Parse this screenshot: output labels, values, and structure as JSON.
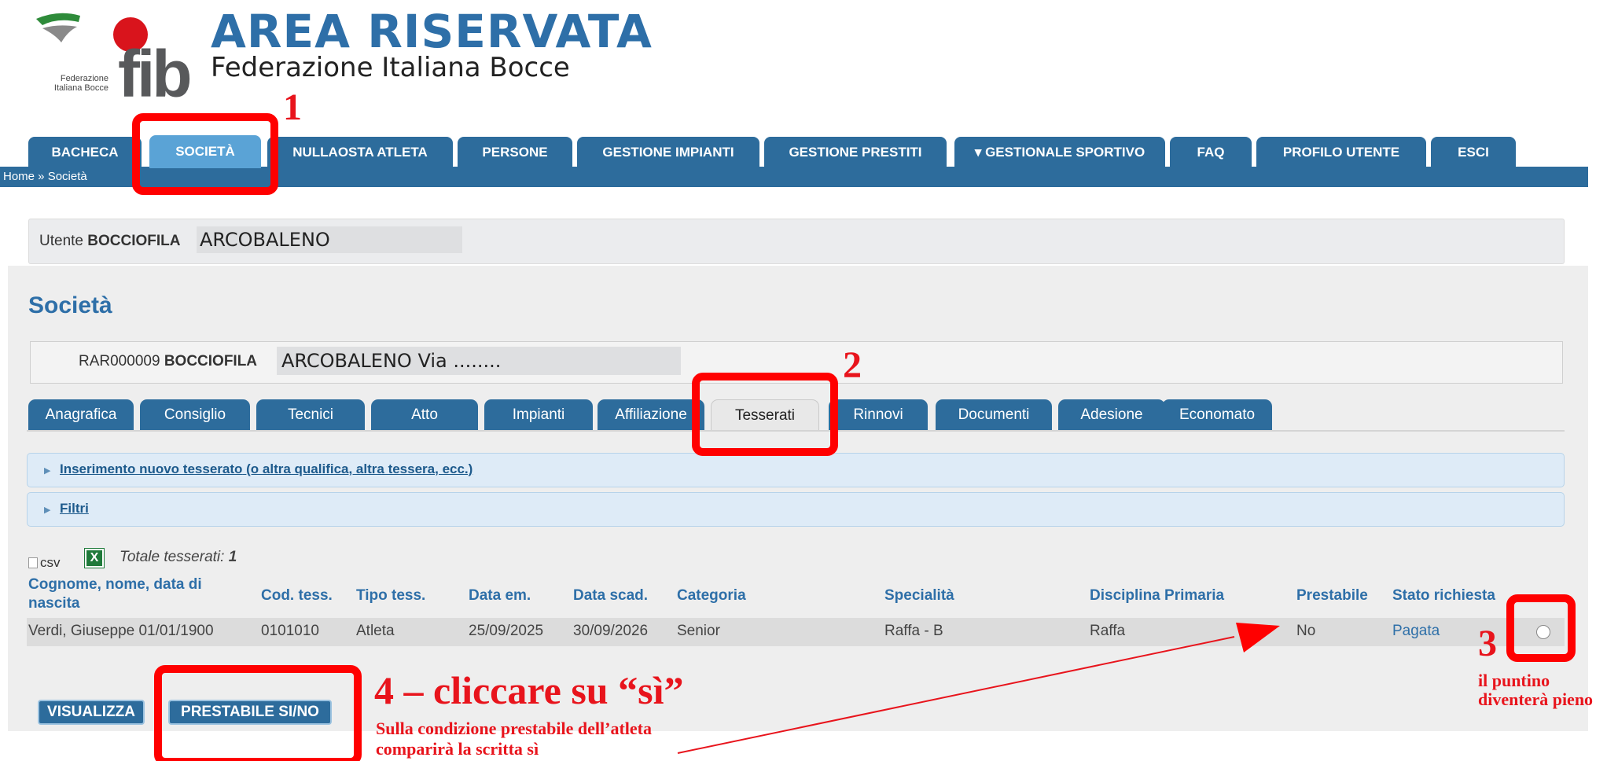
{
  "header": {
    "logo_word": "fib",
    "logo_sub_line1": "Federazione",
    "logo_sub_line2": "Italiana Bocce",
    "title": "AREA RISERVATA",
    "subtitle": "Federazione Italiana Bocce"
  },
  "nav": {
    "tabs": [
      {
        "label": "BACHECA"
      },
      {
        "label": "SOCIETÀ"
      },
      {
        "label": "NULLAOSTA ATLETA"
      },
      {
        "label": "PERSONE"
      },
      {
        "label": "GESTIONE IMPIANTI"
      },
      {
        "label": "GESTIONE PRESTITI"
      },
      {
        "label": "▾ GESTIONALE SPORTIVO"
      },
      {
        "label": "FAQ"
      },
      {
        "label": "PROFILO UTENTE"
      },
      {
        "label": "ESCI"
      }
    ],
    "active": "SOCIETÀ",
    "breadcrumb": "Home » Società"
  },
  "user": {
    "prefix": "Utente",
    "role": "BOCCIOFILA",
    "name": "ARCOBALENO"
  },
  "page": {
    "title": "Società",
    "society_code": "RAR000009",
    "society_type": "BOCCIOFILA",
    "society_name": "ARCOBALENO Via ........"
  },
  "sub_tabs": {
    "items": [
      {
        "label": "Anagrafica"
      },
      {
        "label": "Consiglio"
      },
      {
        "label": "Tecnici"
      },
      {
        "label": "Atto"
      },
      {
        "label": "Impianti"
      },
      {
        "label": "Affiliazione"
      },
      {
        "label": "Tesserati"
      },
      {
        "label": "Rinnovi"
      },
      {
        "label": "Documenti"
      },
      {
        "label": "Adesione"
      },
      {
        "label": "Economato"
      }
    ],
    "active": "Tesserati"
  },
  "accordions": {
    "new_member_link": "Inserimento nuovo tesserato",
    "new_member_note": "(o altra qualifica, altra tessera, ecc.)",
    "filters_link": "Filtri"
  },
  "table": {
    "csv_alt": "csv",
    "xls_icon_letter": "X",
    "total_label": "Totale tesserati:",
    "total_value": "1",
    "columns": {
      "name": "Cognome, nome, data di nascita",
      "code": "Cod. tess.",
      "type": "Tipo tess.",
      "issued": "Data em.",
      "expiry": "Data scad.",
      "category": "Categoria",
      "specialty": "Specialità",
      "discipline": "Disciplina Primaria",
      "loanable": "Prestabile",
      "status": "Stato richiesta"
    },
    "rows": [
      {
        "name": "Verdi, Giuseppe 01/01/1900",
        "code": "0101010",
        "type": "Atleta",
        "issued": "25/09/2025",
        "expiry": "30/09/2026",
        "category": "Senior",
        "specialty": "Raffa - B",
        "discipline": "Raffa",
        "loanable": "No",
        "status": "Pagata"
      }
    ]
  },
  "buttons": {
    "view": "VISUALIZZA",
    "toggle_loanable": "PRESTABILE SI/NO"
  },
  "annotations": {
    "color": "#e8141c",
    "n1": "1",
    "n2": "2",
    "n3": "3",
    "n3_text_line1": "il puntino",
    "n3_text_line2": "diventerà pieno",
    "n4_title": "4 – cliccare su “sì”",
    "n4_text_line1": "Sulla condizione prestabile dell’atleta",
    "n4_text_line2": "comparirà la scritta sì"
  },
  "colors": {
    "primary_blue": "#2d6c9c",
    "active_nav": "#5aa3d6",
    "title_blue": "#2e6fa8",
    "annotation_red": "#ff0000"
  }
}
